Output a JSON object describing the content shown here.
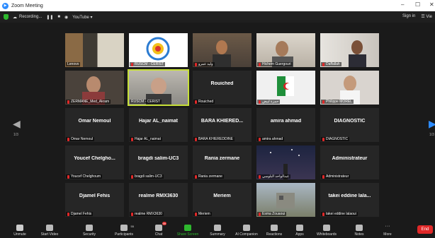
{
  "window": {
    "title": "Zoom Meeting",
    "minimize": "–",
    "maximize": "☐",
    "close": "✕"
  },
  "topbar": {
    "recording": "Recording...",
    "youtube": "YouTube ▾",
    "sign_in": "Sign in",
    "view": "☰ Vie"
  },
  "nav": {
    "page_left": "1/3",
    "page_right": "1/3"
  },
  "participants": [
    {
      "label": "Lenovo"
    },
    {
      "label": "RUSCM - CERIST"
    },
    {
      "label": "وليد عمرو"
    },
    {
      "label": "Hichem Guergouri"
    },
    {
      "label": "Daffallah"
    },
    {
      "label": "ZERMANE_Med_Akram"
    },
    {
      "label": "RUSCM - CERIST"
    },
    {
      "label": "Rouiched",
      "big": "Rouiched"
    },
    {
      "label": "حمزة لبيض"
    },
    {
      "label": "Philippe MOREL"
    },
    {
      "label": "Omar Nemoul",
      "big": "Omar Nemoul"
    },
    {
      "label": "Hajar AL_naimat",
      "big": "Hajar AL_naimat"
    },
    {
      "label": "BARA KHIEREDDINE",
      "big": "BARA KHIERED..."
    },
    {
      "label": "amira ahmad",
      "big": "amira ahmad"
    },
    {
      "label": "DIAGNOSTIC",
      "big": "DIAGNOSTIC"
    },
    {
      "label": "Youcef Chelghoum",
      "big": "Youcef Chelgho..."
    },
    {
      "label": "bragdi salim-UC3",
      "big": "bragdi salim-UC3"
    },
    {
      "label": "Rania zermane",
      "big": "Rania zermane"
    },
    {
      "label": "عبدالواحد البلوسي"
    },
    {
      "label": "Administrateur",
      "big": "Administrateur"
    },
    {
      "label": "Djamel Fehis",
      "big": "Djamel Fehis"
    },
    {
      "label": "realme RMX3630",
      "big": "realme RMX3630"
    },
    {
      "label": "Meriem",
      "big": "Meriem"
    },
    {
      "label": "Esma Zouaoui"
    },
    {
      "label": "takei eddine lalaoui",
      "big": "takei eddine lala..."
    }
  ],
  "toolbar": {
    "unmute": "Unmute",
    "start_video": "Start Video",
    "security": "Security",
    "participants": "Participants",
    "participants_count": "55",
    "chat": "Chat",
    "chat_badge": "99",
    "share": "Share Screen",
    "summary": "Summary",
    "ai": "AI Companion",
    "reactions": "Reactions",
    "apps": "Apps",
    "whiteboards": "Whiteboards",
    "notes": "Notes",
    "more": "More",
    "end": "End"
  }
}
